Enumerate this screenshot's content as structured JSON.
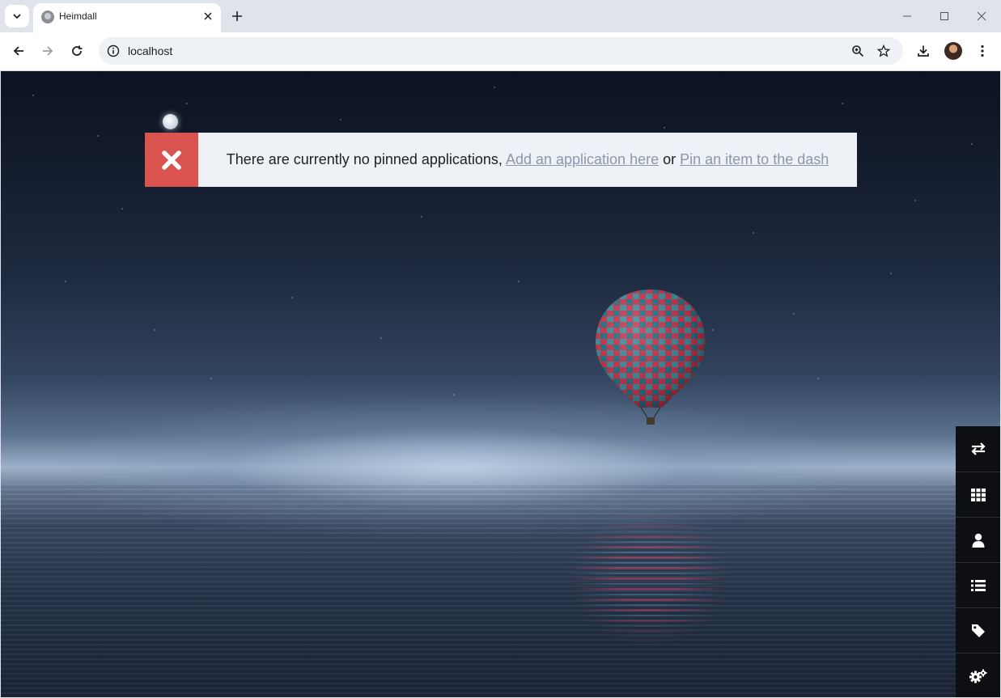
{
  "browser": {
    "tab_title": "Heimdall",
    "url": "localhost"
  },
  "alert": {
    "message": "There are currently no pinned applications,",
    "link_add": "Add an application here",
    "connector": "or",
    "link_pin": "Pin an item to the dash"
  },
  "sidebar": {
    "items": [
      {
        "icon": "switch-arrows-icon"
      },
      {
        "icon": "grid-icon"
      },
      {
        "icon": "user-icon"
      },
      {
        "icon": "list-icon"
      },
      {
        "icon": "tag-icon"
      },
      {
        "icon": "settings-cogs-icon"
      }
    ]
  },
  "colors": {
    "alert_red": "#d9534f",
    "alert_bg": "#eef1f5",
    "link": "#8a98ab",
    "sidebar_bg": "#0d0f13"
  }
}
